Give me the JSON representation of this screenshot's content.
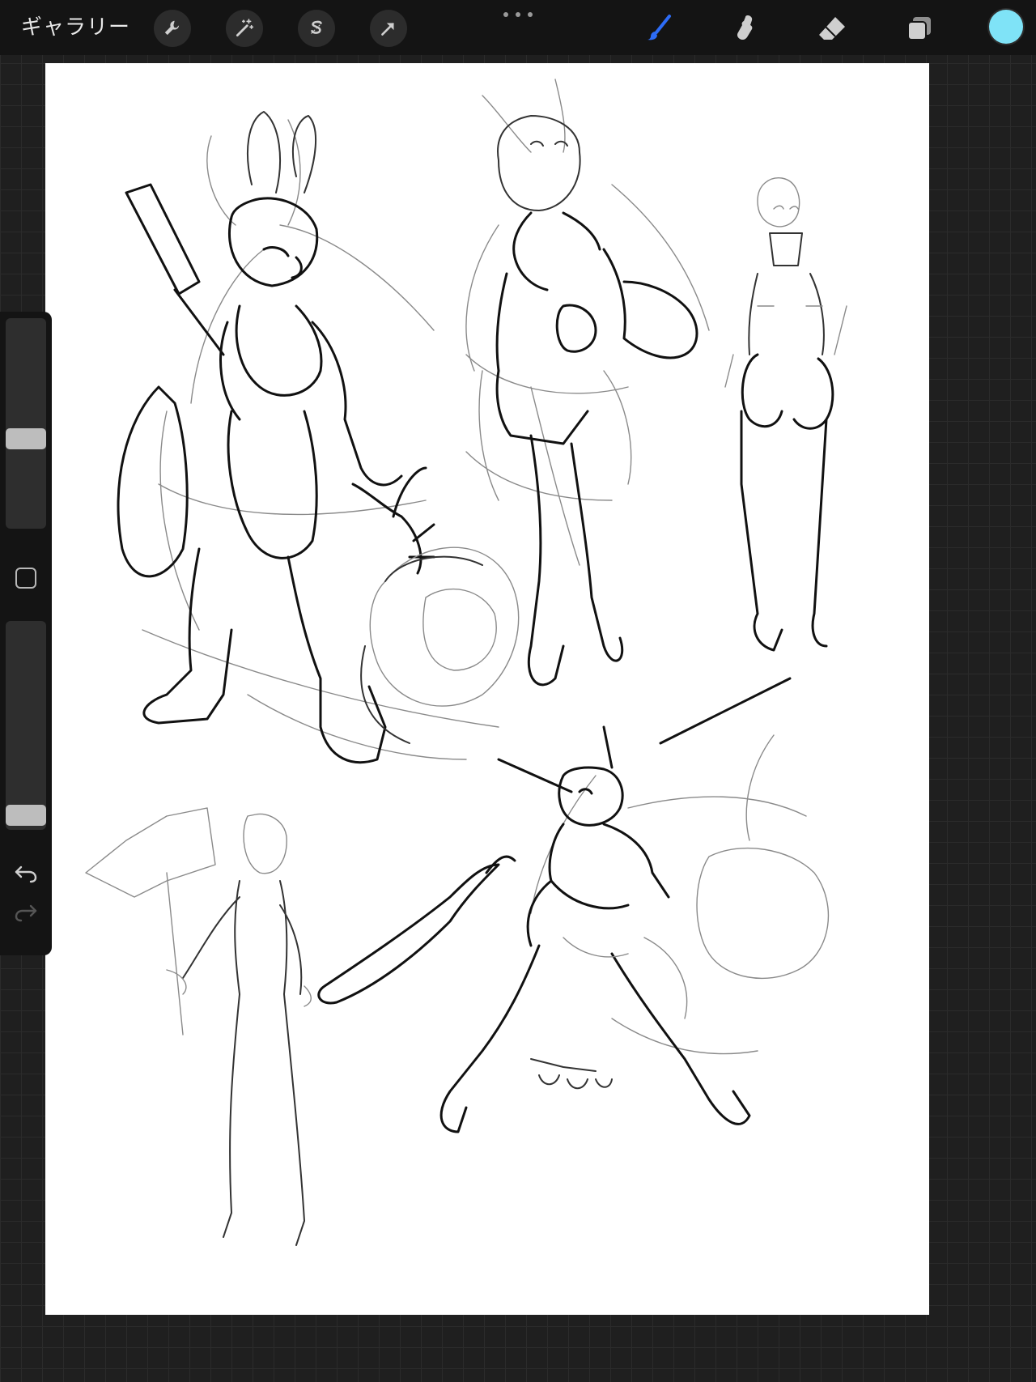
{
  "toolbar": {
    "gallery_label": "ギャラリー",
    "tools_left": [
      {
        "name": "actions",
        "icon": "wrench-icon"
      },
      {
        "name": "adjustments",
        "icon": "magic-wand-icon"
      },
      {
        "name": "selection",
        "icon": "selection-s-icon"
      },
      {
        "name": "transform",
        "icon": "arrow-cursor-icon"
      }
    ],
    "more_icon": "more-dots-icon",
    "tools_right": [
      {
        "name": "brush",
        "icon": "brush-icon",
        "active": true
      },
      {
        "name": "smudge",
        "icon": "smudge-icon",
        "active": false
      },
      {
        "name": "eraser",
        "icon": "eraser-icon",
        "active": false
      },
      {
        "name": "layers",
        "icon": "layers-icon",
        "active": false
      }
    ],
    "current_color": "#7fe3f7",
    "active_color": "#2d6cf6"
  },
  "sidebar": {
    "brush_size_level": 0.42,
    "opacity_level": 0.02,
    "modifier_icon": "square-modifier-icon",
    "undo_icon": "undo-icon",
    "redo_icon": "redo-icon"
  }
}
